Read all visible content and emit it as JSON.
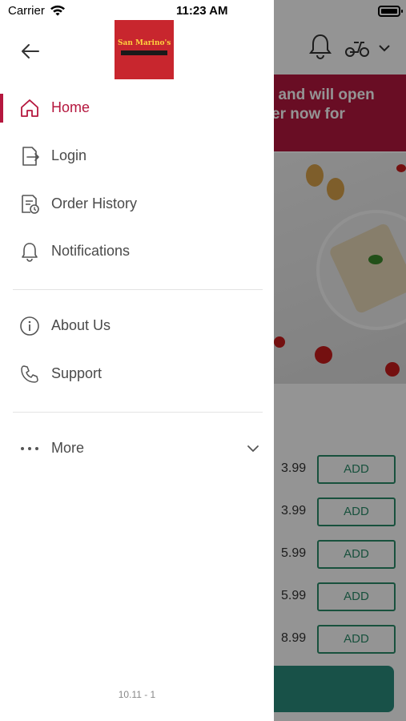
{
  "status_bar": {
    "carrier": "Carrier",
    "time": "11:23 AM"
  },
  "drawer": {
    "logo_text": "San Marino's",
    "back_icon": "arrow-left-icon",
    "active_color": "#b5173e",
    "nav_items": [
      {
        "label": "Home",
        "icon": "home-icon",
        "active": true
      },
      {
        "label": "Login",
        "icon": "login-icon",
        "active": false
      },
      {
        "label": "Order History",
        "icon": "order-history-icon",
        "active": false
      },
      {
        "label": "Notifications",
        "icon": "bell-icon",
        "active": false
      },
      {
        "label": "About Us",
        "icon": "info-icon",
        "active": false
      },
      {
        "label": "Support",
        "icon": "phone-icon",
        "active": false
      },
      {
        "label": "More",
        "icon": "more-dots-icon",
        "active": false
      }
    ],
    "version": "10.11 - 1"
  },
  "background": {
    "banner_line1": "ed and will open",
    "banner_line2": "rder now for",
    "banner_color": "#b5173e",
    "menu_items": [
      {
        "price": "3.99",
        "add_label": "ADD"
      },
      {
        "price": "3.99",
        "add_label": "ADD"
      },
      {
        "price": "5.99",
        "add_label": "ADD"
      },
      {
        "price": "5.99",
        "add_label": "ADD"
      },
      {
        "price": "8.99",
        "add_label": "ADD"
      }
    ]
  }
}
